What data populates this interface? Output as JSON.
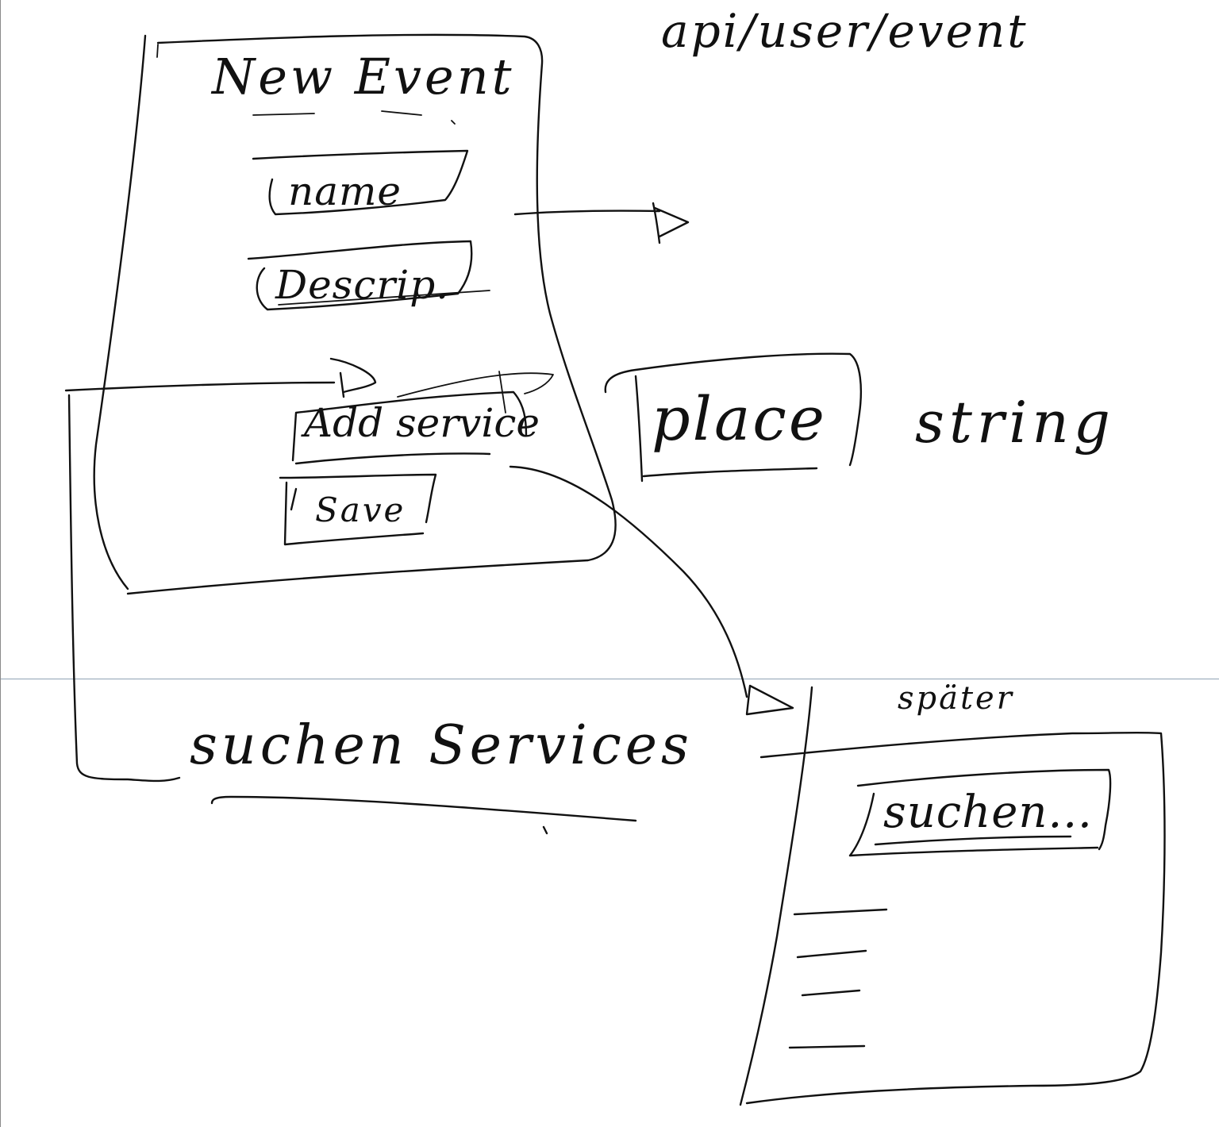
{
  "sketch": {
    "endpoint": "api/user/event",
    "form": {
      "title": "New Event",
      "name_field": "name",
      "description_field": "Descrip.",
      "add_service_button": "Add service",
      "save_button": "Save"
    },
    "place_field": "place",
    "place_type": "string",
    "search_section": "suchen Services",
    "later_panel": {
      "note": "später",
      "search_input": "suchen..."
    }
  }
}
